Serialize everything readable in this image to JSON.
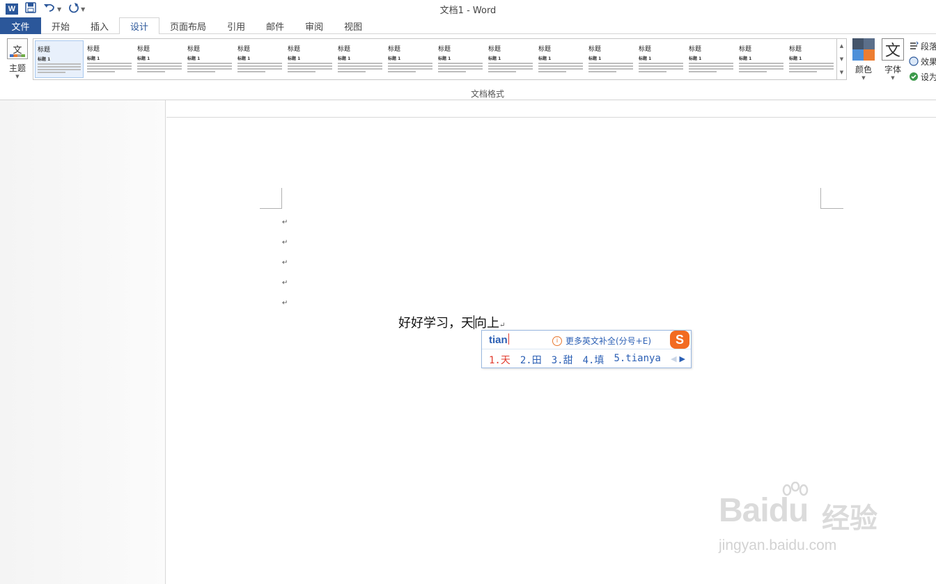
{
  "titlebar": {
    "logo": "W",
    "title": "文档1 - Word",
    "quick_access": [
      "save-icon",
      "undo-icon",
      "redo-icon",
      "customize-icon"
    ]
  },
  "tabs": [
    {
      "label": "文件"
    },
    {
      "label": "开始"
    },
    {
      "label": "插入"
    },
    {
      "label": "设计",
      "active": true
    },
    {
      "label": "页面布局"
    },
    {
      "label": "引用"
    },
    {
      "label": "邮件"
    },
    {
      "label": "审阅"
    },
    {
      "label": "视图"
    }
  ],
  "ribbon": {
    "theme_label": "主题",
    "theme_icon_text": "文",
    "gallery_group_label": "文档格式",
    "gallery_thumb_title": "标题",
    "gallery_thumb_heading": "标题 1",
    "colors_label": "颜色",
    "fonts_label": "字体",
    "fonts_icon_text": "文",
    "side_items": [
      "段落",
      "效果",
      "设为"
    ],
    "theme_colors": [
      "#44546a",
      "#5b6f8a",
      "#4e90d9",
      "#ed7d31"
    ]
  },
  "document": {
    "paragraph_mark": "↵",
    "empty_paragraphs": 5,
    "text_before_caret": "好好学习，天",
    "text_after_caret": "向上"
  },
  "ime": {
    "input": "tian",
    "hint": "更多英文补全(分号+E)",
    "logo": "S",
    "candidates": [
      "1.天",
      "2.田",
      "3.甜",
      "4.填",
      "5.tianya"
    ],
    "accent_color": "#2b5fb4",
    "selected_color": "#e23b2e"
  },
  "watermark": {
    "logo_text": "Bai",
    "logo_text_2": "du",
    "brand": "经验",
    "url": "jingyan.baidu.com"
  }
}
